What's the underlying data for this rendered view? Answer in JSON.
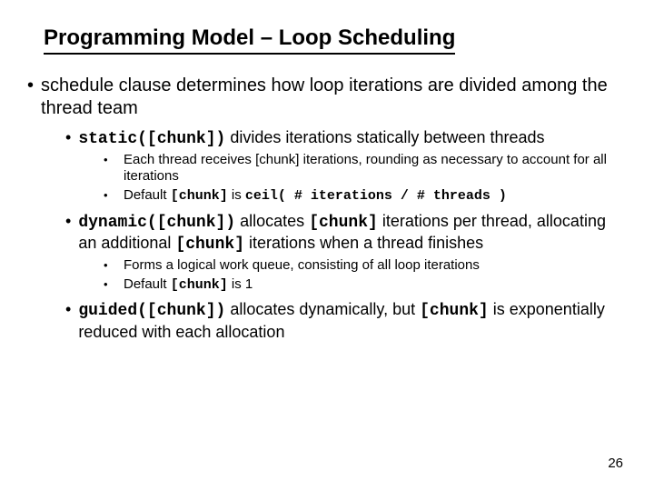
{
  "title": "Programming Model – Loop Scheduling",
  "b1": "schedule clause determines how loop iterations are divided among the thread team",
  "b2_code": "static([chunk])",
  "b2_txt": " divides iterations statically between threads",
  "b2a": "Each thread receives [chunk] iterations, rounding as necessary to account for all iterations",
  "b2b_pre": "Default ",
  "b2b_code1": "[chunk]",
  "b2b_mid": " is ",
  "b2b_code2": "ceil( # iterations / # threads )",
  "b3_code": "dynamic([chunk])",
  "b3_t1": " allocates ",
  "b3_code2": "[chunk]",
  "b3_t2": " iterations per thread, allocating an additional ",
  "b3_code3": "[chunk]",
  "b3_t3": " iterations when a thread finishes",
  "b3a": "Forms a logical work queue, consisting of all loop iterations",
  "b3b_pre": "Default ",
  "b3b_code": "[chunk]",
  "b3b_post": " is 1",
  "b4_code": "guided([chunk])",
  "b4_t1": " allocates dynamically, but ",
  "b4_code2": "[chunk]",
  "b4_t2": " is exponentially reduced with each allocation",
  "pagenum": "26"
}
